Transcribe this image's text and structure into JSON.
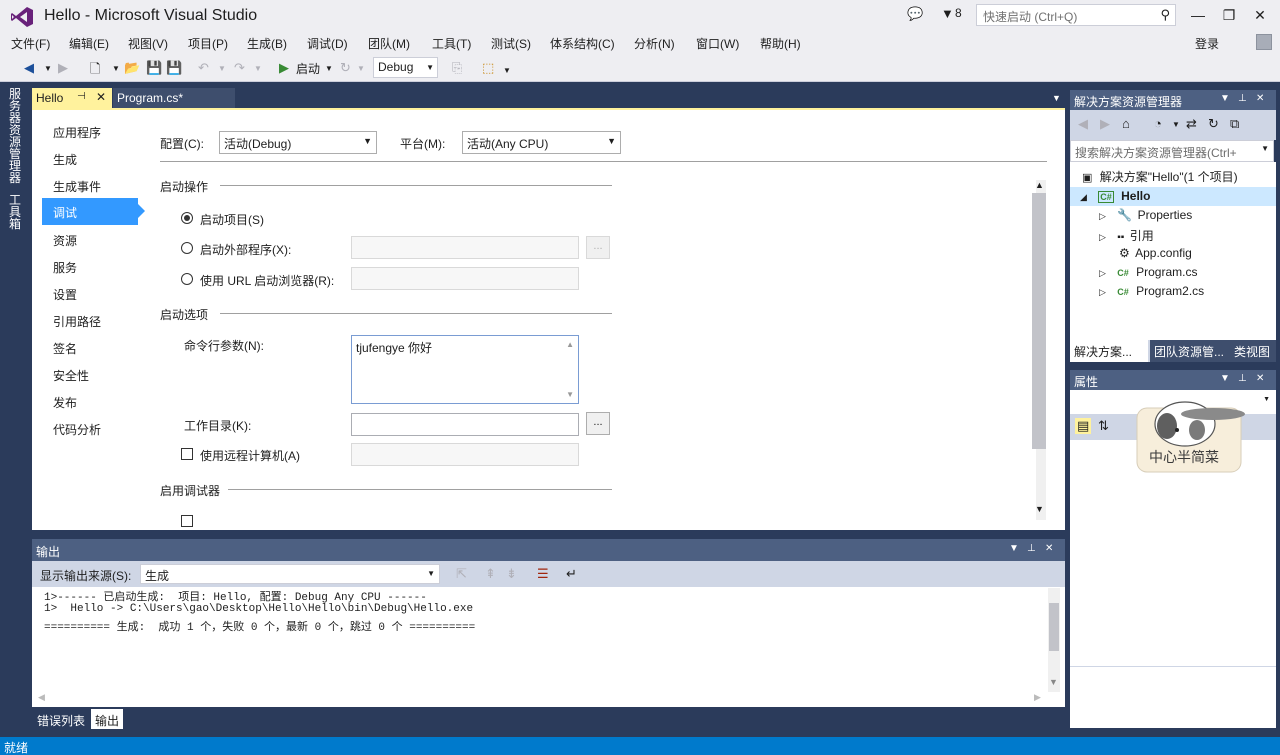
{
  "window": {
    "title": "Hello - Microsoft Visual Studio",
    "notification_count": "8",
    "quick_launch_placeholder": "快速启动 (Ctrl+Q)",
    "login": "登录"
  },
  "menu": [
    "文件(F)",
    "编辑(E)",
    "视图(V)",
    "项目(P)",
    "生成(B)",
    "调试(D)",
    "团队(M)",
    "工具(T)",
    "测试(S)",
    "体系结构(C)",
    "分析(N)",
    "窗口(W)",
    "帮助(H)"
  ],
  "toolbar": {
    "start_label": "启动",
    "config": "Debug"
  },
  "left_tabs": [
    "服务器资源管理器",
    "工具箱"
  ],
  "doc_tabs": {
    "active": "Hello",
    "other": "Program.cs*"
  },
  "prop_nav": [
    "应用程序",
    "生成",
    "生成事件",
    "调试",
    "资源",
    "服务",
    "设置",
    "引用路径",
    "签名",
    "安全性",
    "发布",
    "代码分析"
  ],
  "prop_nav_active": "调试",
  "debug_page": {
    "config_label": "配置(C):",
    "config_value": "活动(Debug)",
    "platform_label": "平台(M):",
    "platform_value": "活动(Any CPU)",
    "start_action_header": "启动操作",
    "start_project": "启动项目(S)",
    "start_external": "启动外部程序(X):",
    "start_url": "使用 URL 启动浏览器(R):",
    "start_options_header": "启动选项",
    "cmd_args_label": "命令行参数(N):",
    "cmd_args_value": "tjufengye  你好",
    "working_dir_label": "工作目录(K):",
    "working_dir_value": "",
    "remote_machine": "使用远程计算机(A)",
    "enable_debuggers_header": "启用调试器",
    "browse": "..."
  },
  "solution_explorer": {
    "title": "解决方案资源管理器",
    "search_placeholder": "搜索解决方案资源管理器(Ctrl+",
    "tree": [
      {
        "label": "解决方案\"Hello\"(1 个项目)",
        "level": 0
      },
      {
        "label": "Hello",
        "level": 1
      },
      {
        "label": "Properties",
        "level": 2
      },
      {
        "label": "引用",
        "level": 2
      },
      {
        "label": "App.config",
        "level": 2
      },
      {
        "label": "Program.cs",
        "level": 2
      },
      {
        "label": "Program2.cs",
        "level": 2
      }
    ],
    "tabs": [
      "解决方案...",
      "团队资源管...",
      "类视图"
    ]
  },
  "properties": {
    "title": "属性",
    "stamp_text": "中心半简菜"
  },
  "output": {
    "title": "输出",
    "source_label": "显示输出来源(S):",
    "source_value": "生成",
    "lines": [
      "1>------ 已启动生成:  项目: Hello, 配置: Debug Any CPU ------",
      "1>  Hello -> C:\\Users\\gao\\Desktop\\Hello\\Hello\\bin\\Debug\\Hello.exe",
      "========== 生成:  成功 1 个，失败 0 个，最新 0 个，跳过 0 个 =========="
    ],
    "tabs": [
      "错误列表",
      "输出"
    ]
  },
  "status": "就绪",
  "colors": {
    "accent": "#007acc",
    "doc_tab_active": "#fff29d",
    "nav_selected": "#3399ff",
    "panel_header": "#4d6082"
  }
}
